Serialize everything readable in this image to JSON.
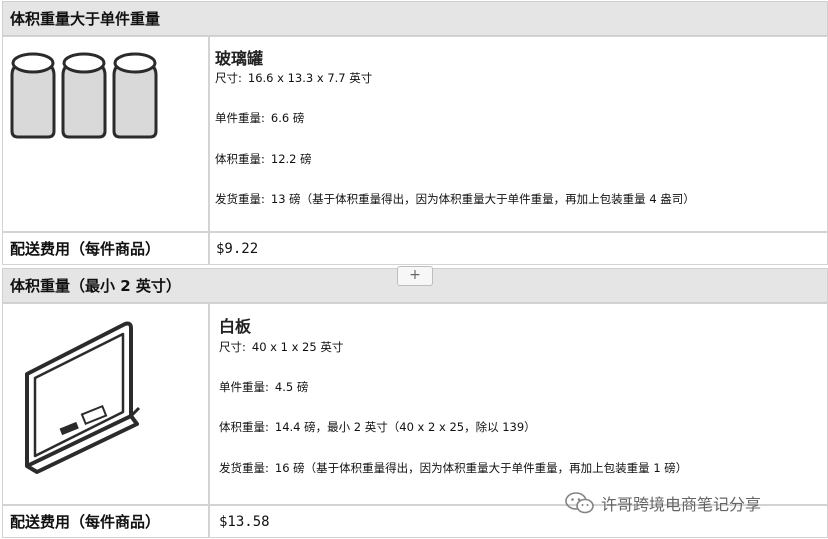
{
  "sections": [
    {
      "header": "体积重量大于单件重量",
      "product": {
        "name": "玻璃罐",
        "icon": "glass-jars-icon",
        "specs": [
          {
            "label": "尺寸:",
            "value": "16.6 x 13.3 x 7.7 英寸"
          },
          {
            "label": "单件重量:",
            "value": "6.6 磅"
          },
          {
            "label": "体积重量:",
            "value": "12.2 磅"
          },
          {
            "label": "发货重量:",
            "value": "13 磅（基于体积重量得出，因为体积重量大于单件重量，再加上包装重量 4 盎司）"
          }
        ]
      },
      "fee_label": "配送费用（每件商品）",
      "fee_value": "$9.22"
    },
    {
      "header": "体积重量（最小 2 英寸）",
      "product": {
        "name": "白板",
        "icon": "whiteboard-icon",
        "specs": [
          {
            "label": "尺寸:",
            "value": "40 x 1 x 25 英寸"
          },
          {
            "label": "单件重量:",
            "value": "4.5 磅"
          },
          {
            "label": "体积重量:",
            "value": "14.4 磅，最小 2 英寸（40 x 2 x 25，除以 139）"
          },
          {
            "label": "发货重量:",
            "value": "16 磅（基于体积重量得出，因为体积重量大于单件重量，再加上包装重量 1 磅）"
          }
        ]
      },
      "fee_label": "配送费用（每件商品）",
      "fee_value": "$13.58"
    }
  ],
  "expand_button": "+",
  "watermark": {
    "icon": "wechat-icon",
    "text": "许哥跨境电商笔记分享"
  }
}
